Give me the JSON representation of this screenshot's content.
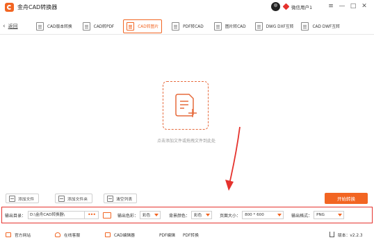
{
  "app": {
    "title": "金舟CAD转换器"
  },
  "user": {
    "name": "微信用户1"
  },
  "window_controls": {
    "menu": "≡",
    "minimize": "—",
    "maximize": "□",
    "close": "✕"
  },
  "nav": {
    "back_label": "返回"
  },
  "tabs": [
    {
      "label": "CAD版本转换"
    },
    {
      "label": "CAD转PDF"
    },
    {
      "label": "CAD转图片",
      "active": true
    },
    {
      "label": "PDF转CAD"
    },
    {
      "label": "图片转CAD"
    },
    {
      "label": "DWG DXF互转"
    },
    {
      "label": "CAD DWF互转"
    }
  ],
  "drop": {
    "text": "点击添加文件或拖拽文件到此处"
  },
  "actions": {
    "add_file": "添加文件",
    "add_folder": "添加文件夹",
    "clear_list": "清空列表",
    "start": "开始转换"
  },
  "options": {
    "output_dir_label": "输出目录：",
    "output_dir_value": "D:\\金舟CAD转换器\\",
    "browse_dots": "•••",
    "color_label": "输出色彩：",
    "color_value": "彩色",
    "bg_label": "背景颜色：",
    "bg_value": "彩色",
    "page_size_label": "页面大小：",
    "page_size_value": "800 * 600",
    "format_label": "输出格式：",
    "format_value": "PNG"
  },
  "footer": {
    "website": "官方网站",
    "support": "在线客服",
    "cad_editor": "CAD编辑器",
    "pdf_editor": "PDF编辑",
    "pdf_convert": "PDF转换",
    "version": "版本：v2.2.3"
  },
  "colors": {
    "accent": "#f26522",
    "highlight_border": "#e5322d"
  },
  "icons": [
    "app-logo-icon",
    "avatar-icon",
    "vip-diamond-icon",
    "menu-icon",
    "minimize-icon",
    "maximize-icon",
    "close-icon",
    "back-arrow-icon",
    "document-icon",
    "document-add-icon",
    "arrow-icon",
    "folder-icon",
    "trash-icon",
    "dropdown-arrow-icon",
    "home-icon",
    "person-icon",
    "edit-icon",
    "version-icon"
  ]
}
